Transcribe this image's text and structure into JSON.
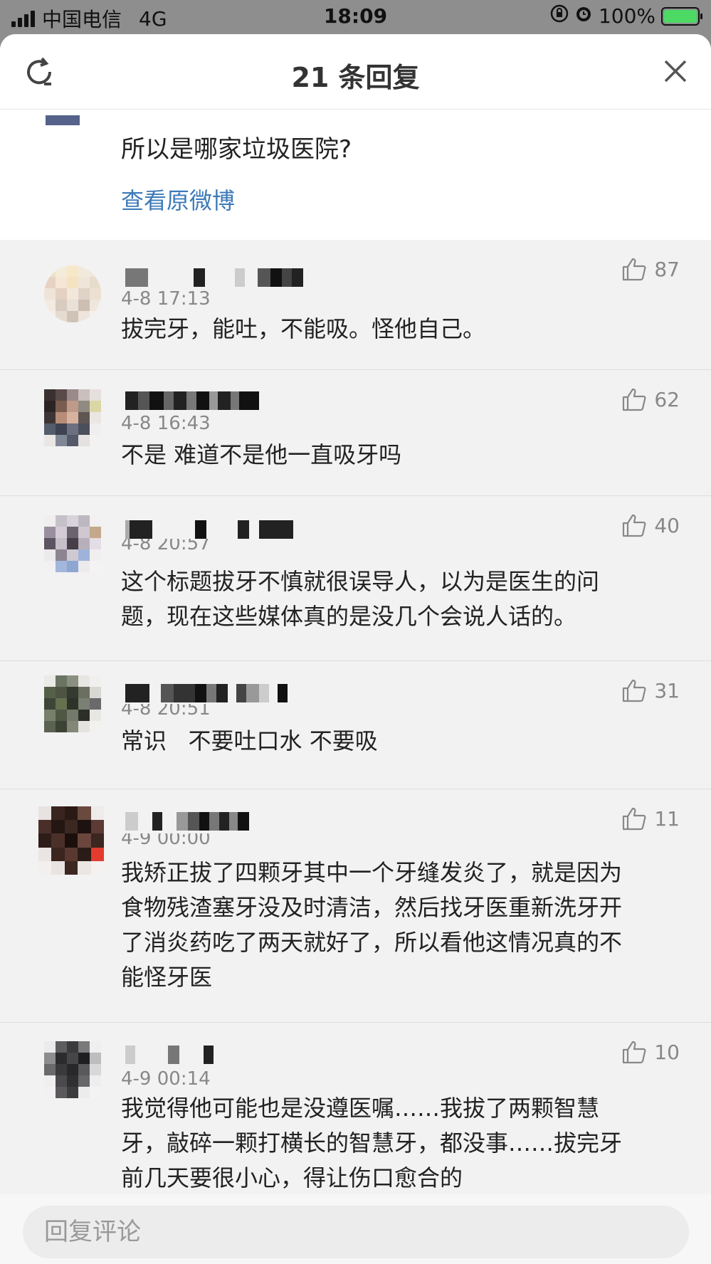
{
  "status_bar": {
    "carrier": "中国电信",
    "network": "4G",
    "time": "18:09",
    "battery": "100%"
  },
  "header": {
    "title": "21 条回复"
  },
  "original": {
    "text": "所以是哪家垃圾医院?",
    "link": "查看原微博"
  },
  "comments": [
    {
      "time": "4-8 17:13",
      "text": "拔完牙，能吐，不能吸。怪他自己。",
      "likes": "87"
    },
    {
      "time": "4-8 16:43",
      "text": "不是 难道不是他一直吸牙吗",
      "likes": "62"
    },
    {
      "time": "4-8 20:57",
      "text": "这个标题拔牙不慎就很误导人，以为是医生的问题，现在这些媒体真的是没几个会说人话的。",
      "likes": "40"
    },
    {
      "time": "4-8 20:51",
      "text": "常识   不要吐口水 不要吸",
      "likes": "31"
    },
    {
      "time": "4-9 00:00",
      "text": "我矫正拔了四颗牙其中一个牙缝发炎了，就是因为食物残渣塞牙没及时清洁，然后找牙医重新洗牙开了消炎药吃了两天就好了，所以看他这情况真的不能怪牙医",
      "likes": "11"
    },
    {
      "time": "4-9 00:14",
      "text": "我觉得他可能也是没遵医嘱……我拔了两颗智慧牙，敲碎一颗打横长的智慧牙，都没事……拔完牙前几天要很小心，得让伤口愈合的",
      "likes": "10"
    }
  ],
  "footer": {
    "placeholder": "回复评论"
  },
  "icons": {
    "refresh": "refresh-icon",
    "close": "close-icon",
    "like": "thumbs-up-icon"
  },
  "colors": {
    "link": "#3d7ab8",
    "battery": "#4cd964"
  }
}
